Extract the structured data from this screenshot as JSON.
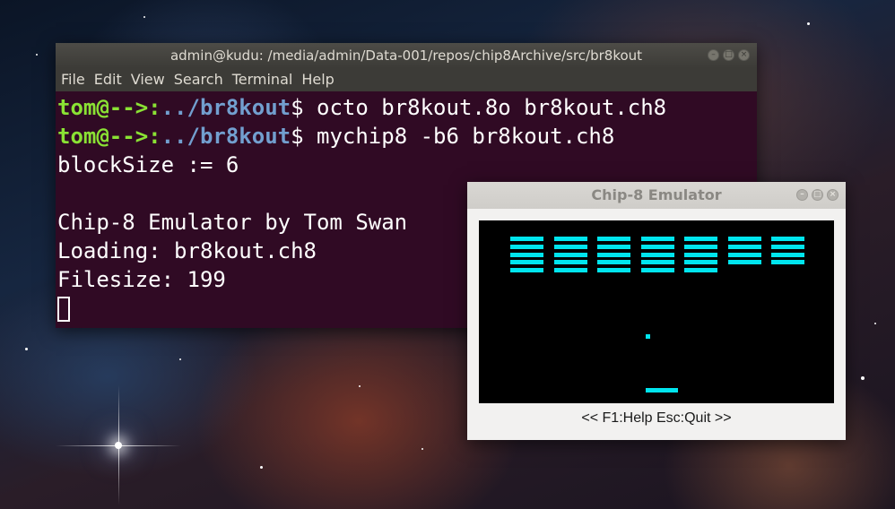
{
  "terminal": {
    "title": "admin@kudu: /media/admin/Data-001/repos/chip8Archive/src/br8kout",
    "menu": [
      "File",
      "Edit",
      "View",
      "Search",
      "Terminal",
      "Help"
    ],
    "prompt_user": "tom@-->:",
    "prompt_path": "../br8kout",
    "prompt_symbol": "$",
    "commands": [
      "octo br8kout.8o br8kout.ch8",
      "mychip8 -b6 br8kout.ch8"
    ],
    "output": [
      "blockSize := 6",
      "",
      "Chip-8 Emulator by Tom Swan",
      "Loading: br8kout.ch8",
      "Filesize: 199"
    ],
    "colors": {
      "background": "#300a24",
      "user": "#8ae234",
      "path": "#729fcf",
      "text": "#ffffff"
    }
  },
  "emulator": {
    "title": "Chip-8 Emulator",
    "status": "<< F1:Help Esc:Quit >>",
    "colors": {
      "pixel": "#00e5ee",
      "screen": "#000000"
    },
    "game": {
      "brick_columns": 7,
      "brick_rows_per_column": [
        5,
        5,
        5,
        5,
        5,
        4,
        4
      ]
    }
  }
}
